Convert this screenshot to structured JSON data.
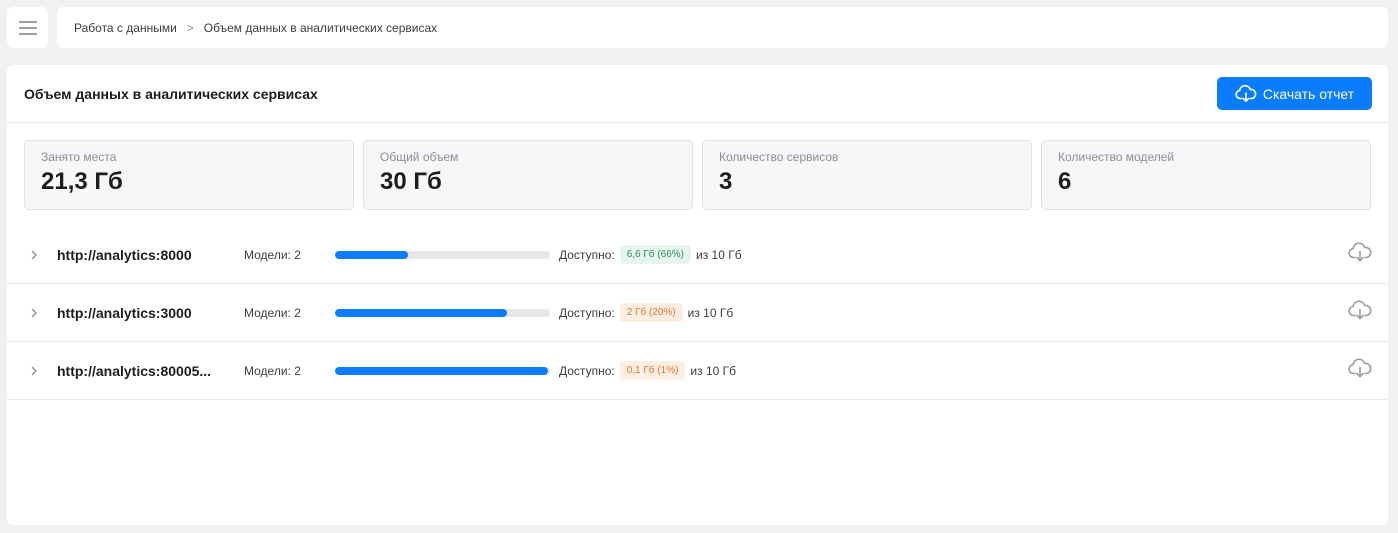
{
  "breadcrumb": {
    "items": [
      "Работа с данными",
      "Объем данных в аналитических сервисах"
    ],
    "separator": ">"
  },
  "panel": {
    "title": "Объем данных в аналитических сервисах",
    "download_label": "Скачать отчет"
  },
  "stats": [
    {
      "label": "Занято места",
      "value": "21,3 Гб"
    },
    {
      "label": "Общий объем",
      "value": "30 Гб"
    },
    {
      "label": "Количество сервисов",
      "value": "3"
    },
    {
      "label": "Количество моделей",
      "value": "6"
    }
  ],
  "services": [
    {
      "host": "http://analytics:8000",
      "models": "Модели: 2",
      "used_fraction": 0.34,
      "available_label": "Доступно:",
      "free": "6,6 Гб (66%)",
      "free_status": "green",
      "total": "из 10 Гб"
    },
    {
      "host": "http://analytics:3000",
      "models": "Модели: 2",
      "used_fraction": 0.8,
      "available_label": "Доступно:",
      "free": "2 Гб (20%)",
      "free_status": "orange",
      "total": "из 10 Гб"
    },
    {
      "host": "http://analytics:80005...",
      "models": "Модели: 2",
      "used_fraction": 0.99,
      "available_label": "Доступно:",
      "free": "0,1 Гб (1%)",
      "free_status": "orange",
      "total": "из 10 Гб"
    }
  ],
  "colors": {
    "accent": "#0a7cff",
    "success_bg": "#e6f6ef",
    "success_text": "#2e8b5e",
    "warning_bg": "#fdeee3",
    "warning_text": "#e0762c"
  },
  "icons": {
    "menu": "hamburger-icon",
    "download": "cloud-download-icon",
    "expand": "chevron-right-icon"
  }
}
